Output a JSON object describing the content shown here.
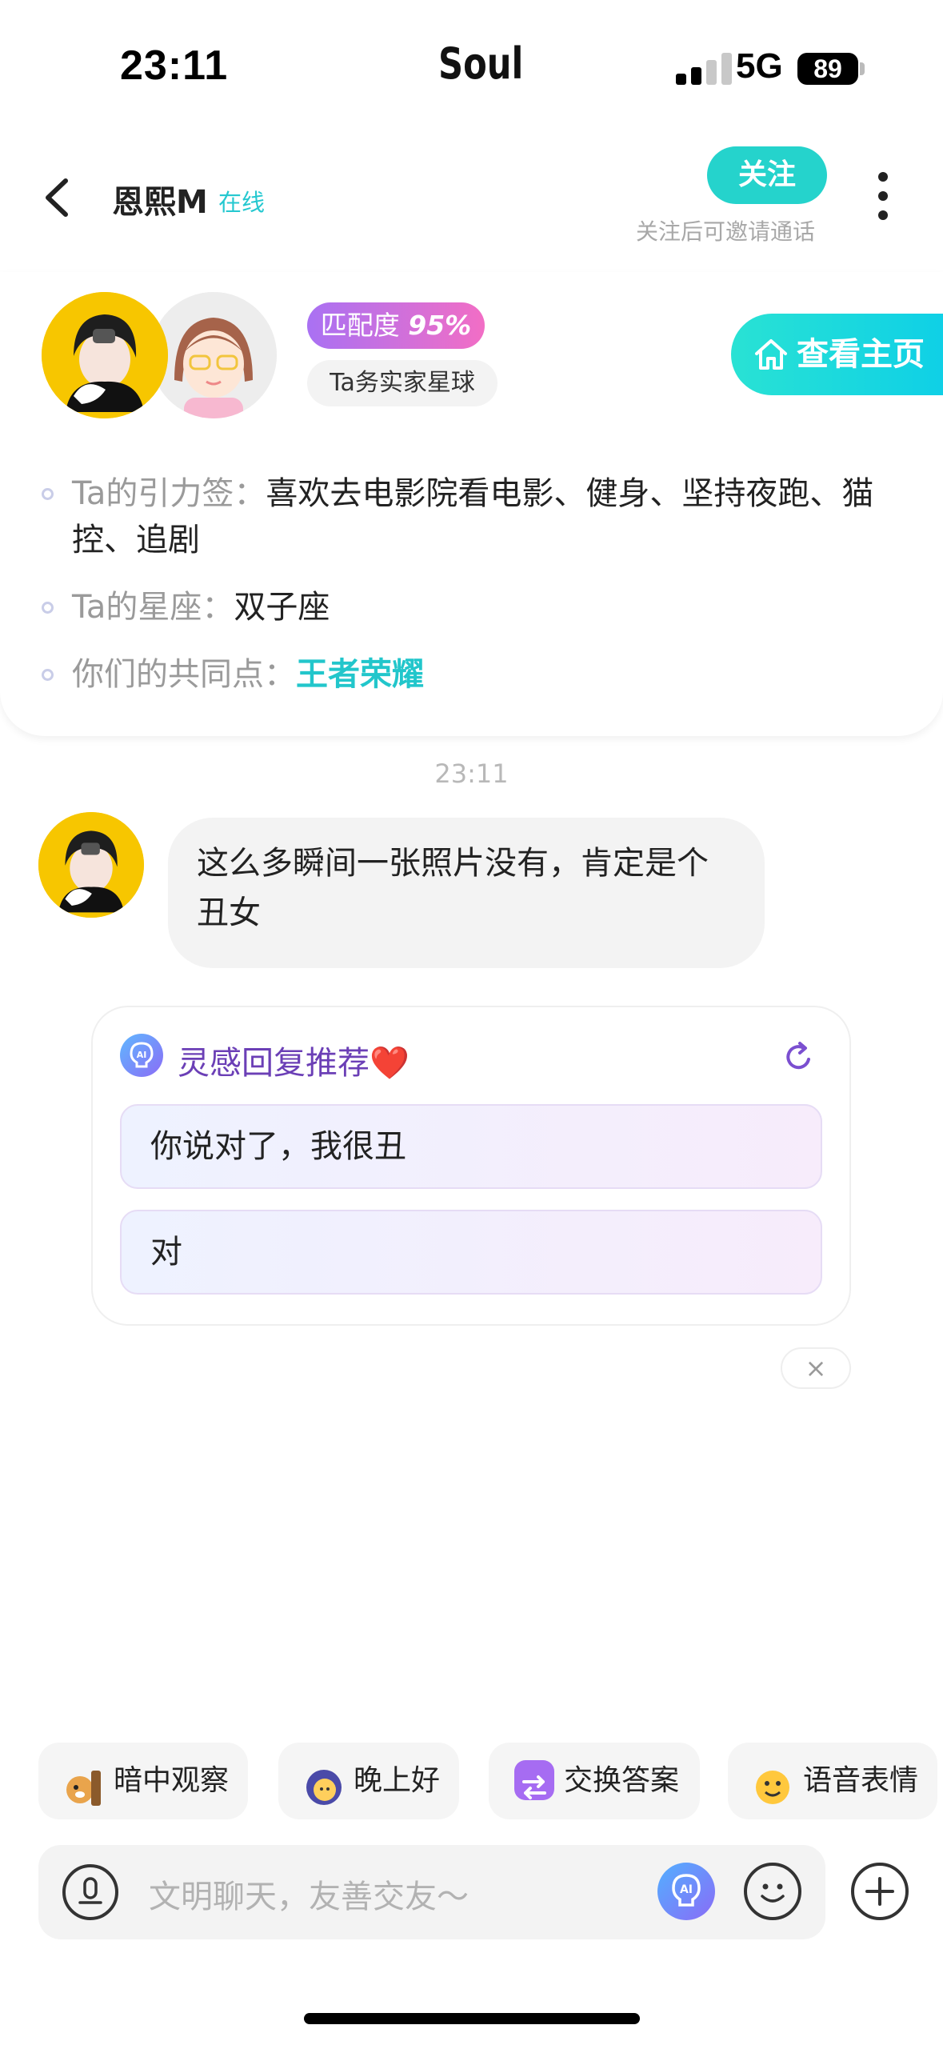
{
  "status_bar": {
    "time": "23:11",
    "app_name": "Soul",
    "network": "5G",
    "battery": "89"
  },
  "header": {
    "name": "恩熙M",
    "online": "在线",
    "follow_label": "关注",
    "follow_hint": "关注后可邀请通话"
  },
  "profile": {
    "match_label": "匹配度",
    "match_value": "95%",
    "planet_tag": "Ta务实家星球",
    "home_button": "查看主页",
    "attraction_label": "Ta的引力签：",
    "attraction_value": "喜欢去电影院看电影、健身、坚持夜跑、猫控、追剧",
    "zodiac_label": "Ta的星座：",
    "zodiac_value": "双子座",
    "common_label": "你们的共同点：",
    "common_value": "王者荣耀"
  },
  "chat": {
    "timestamp": "23:11",
    "message": "这么多瞬间一张照片没有，肯定是个丑女"
  },
  "ai_suggest": {
    "title": "灵感回复推荐❤️",
    "items": [
      "你说对了，我很丑",
      "对"
    ],
    "close": "×"
  },
  "quick_actions": [
    {
      "label": "暗中观察",
      "icon": "dog-peek-icon"
    },
    {
      "label": "晚上好",
      "icon": "moon-icon"
    },
    {
      "label": "交换答案",
      "icon": "swap-icon"
    },
    {
      "label": "语音表情",
      "icon": "voice-emoji-icon"
    }
  ],
  "input": {
    "placeholder": "文明聊天，友善交友～"
  },
  "colors": {
    "accent": "#25d3cc",
    "ai_purple": "#6b3fb6",
    "common_point": "#22c6cb"
  }
}
